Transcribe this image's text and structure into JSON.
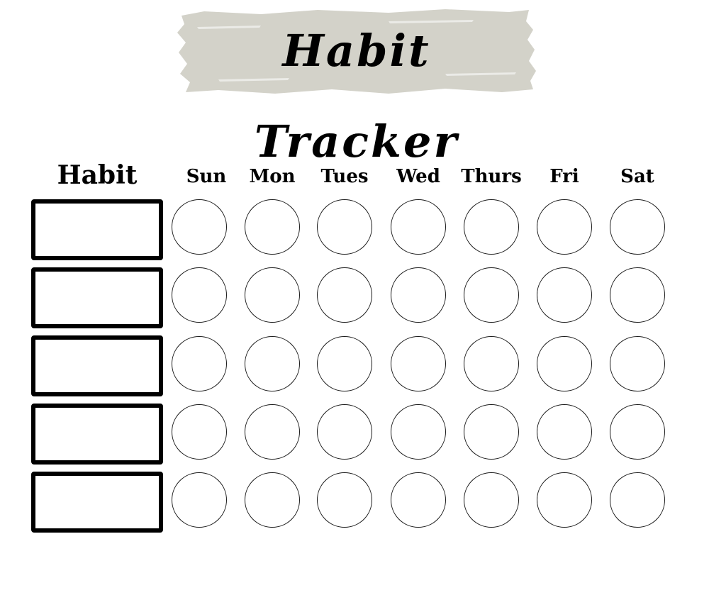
{
  "title": "Habit Tracker",
  "banner_color": "#d3d2c9",
  "habit_header": "Habit",
  "days": [
    "Sun",
    "Mon",
    "Tues",
    "Wed",
    "Thurs",
    "Fri",
    "Sat"
  ],
  "habits": [
    {
      "name": "",
      "checks": [
        false,
        false,
        false,
        false,
        false,
        false,
        false
      ]
    },
    {
      "name": "",
      "checks": [
        false,
        false,
        false,
        false,
        false,
        false,
        false
      ]
    },
    {
      "name": "",
      "checks": [
        false,
        false,
        false,
        false,
        false,
        false,
        false
      ]
    },
    {
      "name": "",
      "checks": [
        false,
        false,
        false,
        false,
        false,
        false,
        false
      ]
    },
    {
      "name": "",
      "checks": [
        false,
        false,
        false,
        false,
        false,
        false,
        false
      ]
    }
  ]
}
